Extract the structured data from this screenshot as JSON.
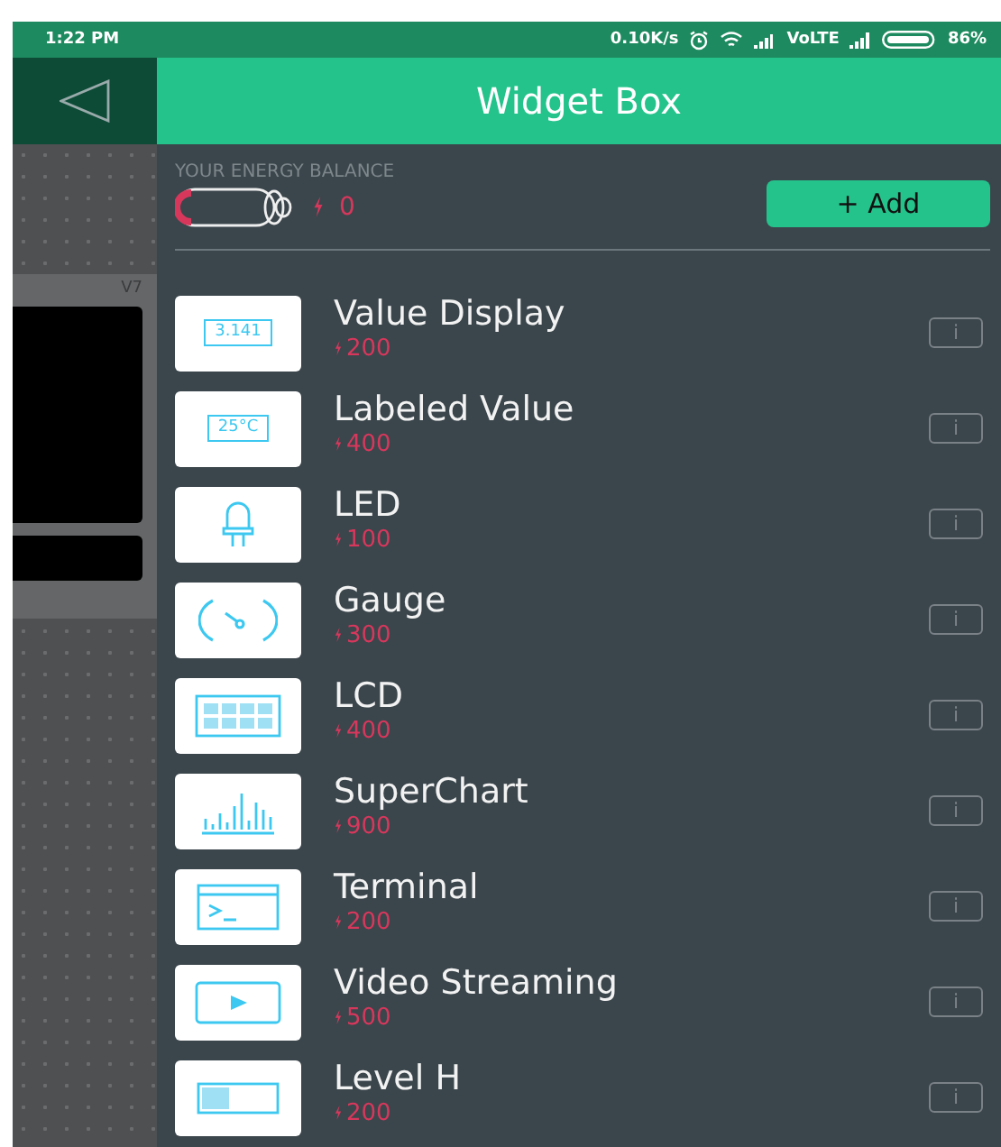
{
  "status_bar": {
    "time": "1:22 PM",
    "speed": "0.10K/s",
    "network": "VoLTE",
    "battery": "86%"
  },
  "header": {
    "title": "Widget Box"
  },
  "canvas": {
    "widget_label": "V7"
  },
  "energy": {
    "label": "YOUR ENERGY BALANCE",
    "balance": "0",
    "add_button": "+ Add"
  },
  "widgets": [
    {
      "kind": "value",
      "icon_text": "3.141",
      "name": "Value Display",
      "price": "200",
      "info": "i"
    },
    {
      "kind": "labeled",
      "icon_text": "25°C",
      "name": "Labeled Value",
      "price": "400",
      "info": "i"
    },
    {
      "kind": "led",
      "name": "LED",
      "price": "100",
      "info": "i"
    },
    {
      "kind": "gauge",
      "name": "Gauge",
      "price": "300",
      "info": "i"
    },
    {
      "kind": "lcd",
      "name": "LCD",
      "price": "400",
      "info": "i"
    },
    {
      "kind": "chart",
      "name": "SuperChart",
      "price": "900",
      "info": "i"
    },
    {
      "kind": "terminal",
      "name": "Terminal",
      "price": "200",
      "info": "i"
    },
    {
      "kind": "video",
      "name": "Video Streaming",
      "price": "500",
      "info": "i"
    },
    {
      "kind": "level",
      "name": "Level H",
      "price": "200",
      "info": "i"
    }
  ]
}
